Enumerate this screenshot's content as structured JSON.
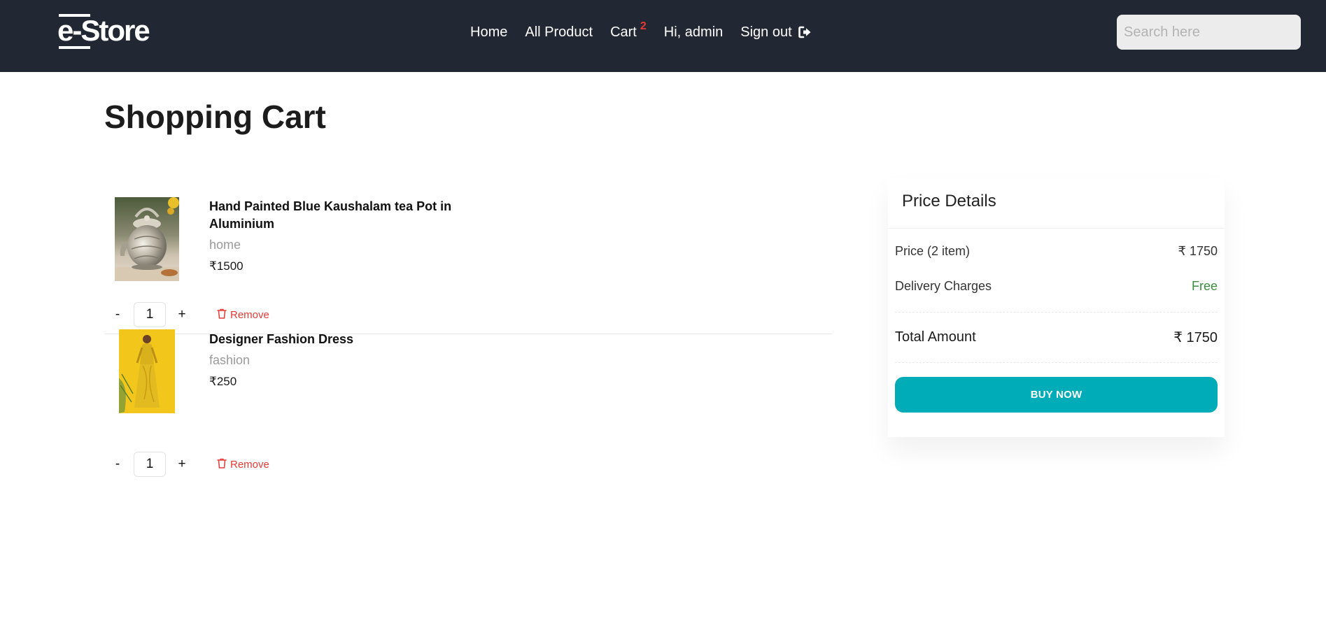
{
  "header": {
    "logo_text": "e-Store",
    "nav": {
      "home": "Home",
      "all_product": "All Product",
      "cart": "Cart",
      "cart_count": "2",
      "greeting": "Hi, admin",
      "sign_out": "Sign out"
    },
    "search_placeholder": "Search here",
    "search_value": ""
  },
  "page_title": "Shopping Cart",
  "cart": {
    "items": [
      {
        "name": "Hand Painted Blue Kaushalam tea Pot in Aluminium",
        "category": "home",
        "price": "₹1500",
        "quantity": "1",
        "minus_label": "-",
        "plus_label": "+",
        "remove_label": "Remove",
        "image_icon": "teapot-image"
      },
      {
        "name": "Designer Fashion Dress",
        "category": "fashion",
        "price": "₹250",
        "quantity": "1",
        "minus_label": "-",
        "plus_label": "+",
        "remove_label": "Remove",
        "image_icon": "dress-image"
      }
    ]
  },
  "price_details": {
    "title": "Price Details",
    "price_label": "Price (2 item)",
    "price_value": "₹ 1750",
    "delivery_label": "Delivery Charges",
    "delivery_value": "Free",
    "total_label": "Total Amount",
    "total_value": "₹ 1750",
    "buy_label": "BUY NOW"
  },
  "colors": {
    "navbar": "#222833",
    "accent": "#00acb8",
    "badge": "#e53935",
    "remove": "#e53935",
    "free": "#388e3c"
  },
  "icons": {
    "sign_out": "sign-out-icon",
    "remove": "trash-icon"
  }
}
